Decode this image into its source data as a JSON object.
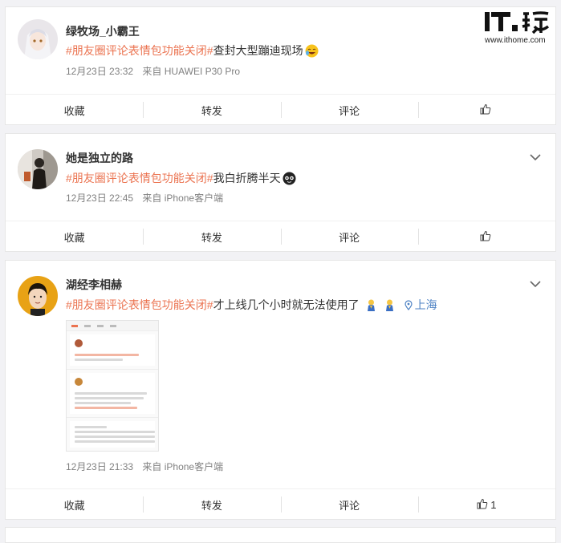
{
  "brand": {
    "url": "www.ithome.com"
  },
  "actions_labels": {
    "collect": "收藏",
    "repost": "转发",
    "comment": "评论"
  },
  "posts": [
    {
      "username": "绿牧场_小霸王",
      "topic": "#朋友圈评论表情包功能关闭#",
      "text": "查封大型蹦迪现场",
      "time": "12月23日 23:32",
      "source": "来自 HUAWEI P30 Pro",
      "likes": ""
    },
    {
      "username": "她是独立的路",
      "topic": "#朋友圈评论表情包功能关闭#",
      "text": "我白折腾半天",
      "time": "12月23日 22:45",
      "source": "来自 iPhone客户端",
      "likes": ""
    },
    {
      "username": "湖经李相赫",
      "topic": "#朋友圈评论表情包功能关闭#",
      "text": "才上线几个小时就无法使用了",
      "location": "上海",
      "time": "12月23日 21:33",
      "source": "来自 iPhone客户端",
      "likes": "1"
    }
  ],
  "colors": {
    "topic": "#eb7350",
    "location": "#4d82c4",
    "meta": "#808080",
    "background": "#f2f2f5"
  },
  "icons": [
    "it-home-logo",
    "chevron-down-icon",
    "thumbs-up-icon",
    "location-pin-icon",
    "laughing-emoji",
    "dizzy-emoji",
    "praying-emoji"
  ]
}
